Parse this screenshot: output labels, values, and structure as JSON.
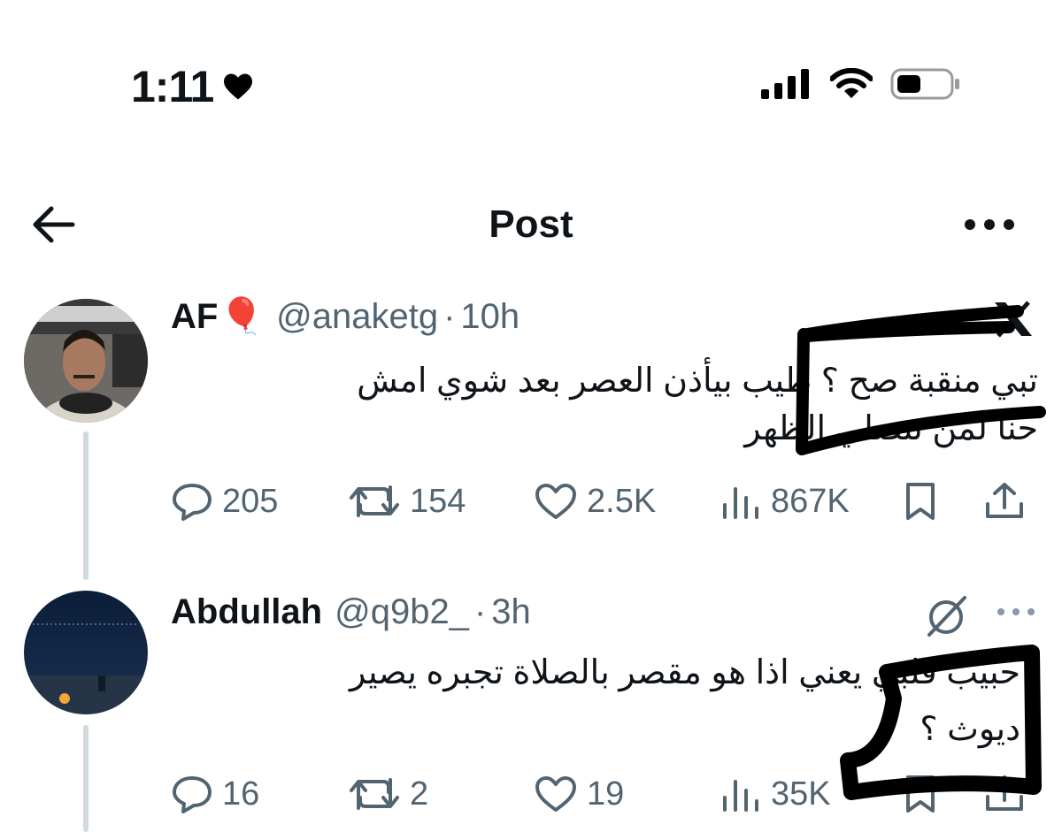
{
  "status_bar": {
    "time": "1:11"
  },
  "header": {
    "title": "Post"
  },
  "posts": [
    {
      "name": "AF",
      "name_emoji": "🎈",
      "handle": "@anaketg",
      "separator": "·",
      "time": "10h",
      "text_line1": "تبي منقبة صح ؟ طيب بيأذن العصر بعد شوي امش",
      "text_line2": "حنا لمن تنصلي الظهر",
      "replies": "205",
      "reposts": "154",
      "likes": "2.5K",
      "views": "867K"
    },
    {
      "name": "Abdullah",
      "handle": "@q9b2_",
      "separator": "·",
      "time": "3h",
      "text_line1": "حبيب قلبي يعني اذا هو مقصر بالصلاة تجبره يصير",
      "text_line2": "ديوث ؟",
      "replies": "16",
      "reposts": "2",
      "likes": "19",
      "views": "35K"
    }
  ],
  "icons": {
    "status": [
      "heart-icon",
      "signal-icon",
      "wifi-icon",
      "battery-icon"
    ],
    "header": [
      "back-arrow-icon",
      "more-icon"
    ],
    "post": [
      "x-logo-icon",
      "grok-icon",
      "reply-icon",
      "repost-icon",
      "like-icon",
      "views-icon",
      "bookmark-icon",
      "share-icon"
    ]
  },
  "colors": {
    "text": "#0f1419",
    "secondary": "#536471",
    "thread": "#cfd9de"
  }
}
